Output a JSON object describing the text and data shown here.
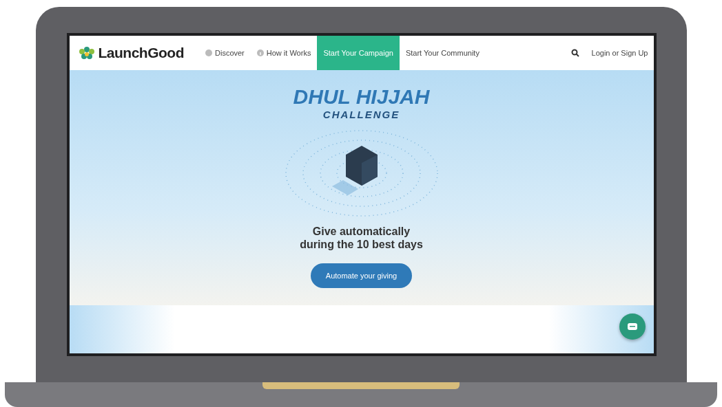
{
  "brand": {
    "name": "LaunchGood"
  },
  "nav": [
    {
      "label": "Discover",
      "kind": "globe",
      "selected": false
    },
    {
      "label": "How it Works",
      "kind": "info",
      "selected": false
    },
    {
      "label": "Start Your Campaign",
      "kind": "plain",
      "selected": true
    },
    {
      "label": "Start Your Community",
      "kind": "plain",
      "selected": false
    }
  ],
  "login": "Login or Sign Up",
  "hero": {
    "title": "DHUL HIJJAH",
    "subtitle": "CHALLENGE",
    "tagline": "Give automatically",
    "tagline2": "during the 10 best days",
    "button": "Automate your giving"
  }
}
